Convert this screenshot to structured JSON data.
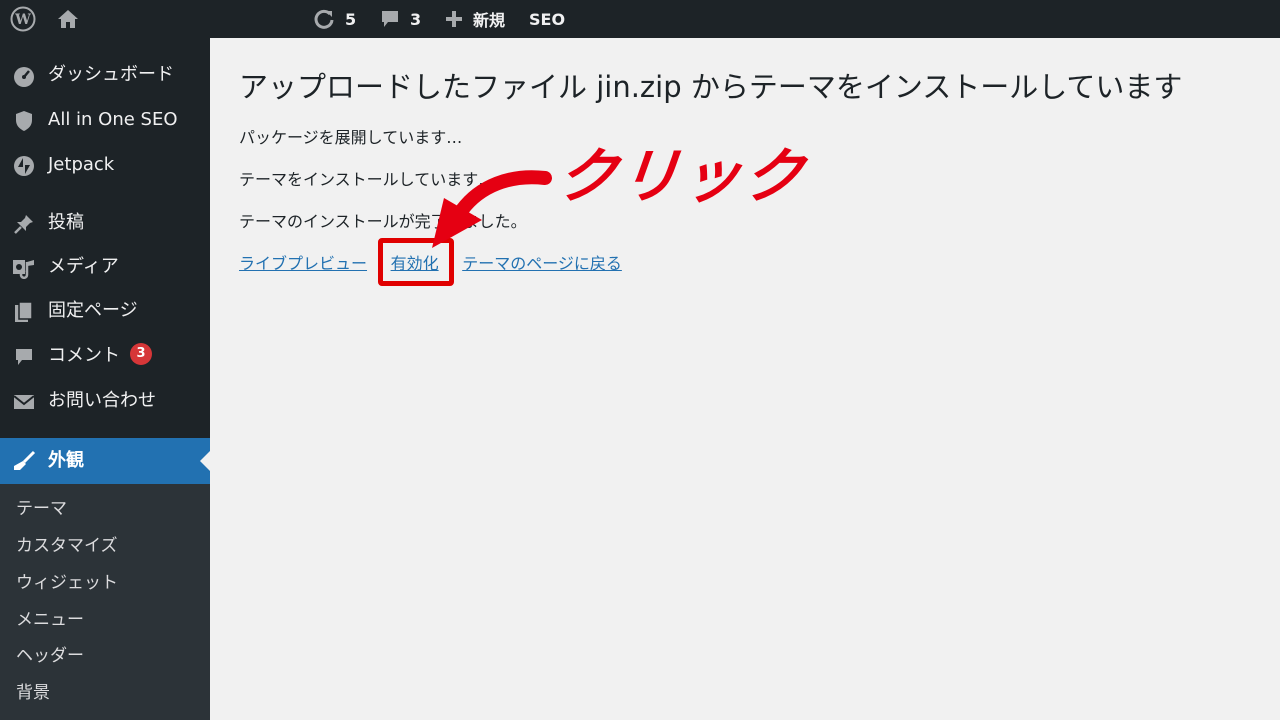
{
  "adminbar": {
    "updates_count": "5",
    "comments_count": "3",
    "new_label": "新規",
    "seo_label": "SEO"
  },
  "sidebar": {
    "items": [
      {
        "label": "ダッシュボード",
        "icon": "dashboard-icon"
      },
      {
        "label": "All in One SEO",
        "icon": "shield-icon"
      },
      {
        "label": "Jetpack",
        "icon": "jetpack-icon"
      },
      {
        "label": "投稿",
        "icon": "pin-icon"
      },
      {
        "label": "メディア",
        "icon": "media-icon"
      },
      {
        "label": "固定ページ",
        "icon": "page-icon"
      },
      {
        "label": "コメント",
        "icon": "comment-icon",
        "badge": "3"
      },
      {
        "label": "お問い合わせ",
        "icon": "mail-icon"
      },
      {
        "label": "外観",
        "icon": "brush-icon",
        "active": true
      }
    ],
    "submenu": [
      "テーマ",
      "カスタマイズ",
      "ウィジェット",
      "メニュー",
      "ヘッダー",
      "背景"
    ]
  },
  "main": {
    "title": "アップロードしたファイル jin.zip からテーマをインストールしています",
    "messages": [
      "パッケージを展開しています…",
      "テーマをインストールしています…",
      "テーマのインストールが完了しました。"
    ],
    "links": {
      "live_preview": "ライブプレビュー",
      "activate": "有効化",
      "separator": "|",
      "back_to_themes": "テーマのページに戻る"
    }
  },
  "annotation": {
    "label": "クリック",
    "color": "#e50012"
  },
  "colors": {
    "adminbar_bg": "#1d2327",
    "active_menu": "#2271b1",
    "link": "#2271b1",
    "badge": "#d63638"
  }
}
